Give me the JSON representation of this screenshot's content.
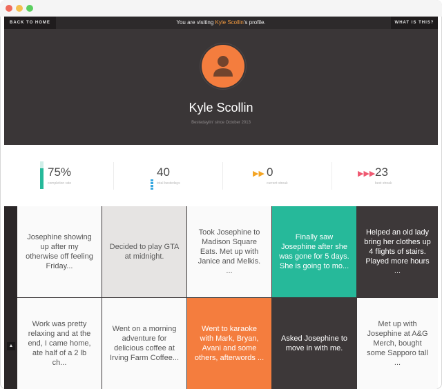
{
  "topbar": {
    "back_label": "BACK TO HOME",
    "what_label": "WHAT IS THIS?",
    "visit_prefix": "You are visiting ",
    "visit_name": "Kyle Scollin",
    "visit_suffix": "'s profile."
  },
  "profile": {
    "avatar_icon": "user-silhouette-icon",
    "name": "Kyle Scollin",
    "since": "Bestedaylin' since October 2013"
  },
  "stats": {
    "completion": {
      "value": "75%",
      "label": "completion rate",
      "fraction": 0.75,
      "color": "#26b99a"
    },
    "total": {
      "value": "40",
      "label": "total bestedays",
      "color": "#38a8e0"
    },
    "current": {
      "value": "0",
      "label": "current streak",
      "icon": "double-chevron-icon",
      "color": "#f4a524"
    },
    "best": {
      "value": "23",
      "label": "best streak",
      "icon": "triple-chevron-icon",
      "color": "#ef5a72"
    }
  },
  "cards": [
    {
      "text": "Josephine showing up after my otherwise off feeling Friday...",
      "style": "white"
    },
    {
      "text": "Decided to play GTA at midnight.",
      "style": "gray"
    },
    {
      "text": "Took Josephine to Madison Square Eats. Met up with Janice and Melkis. ...",
      "style": "white"
    },
    {
      "text": "Finally saw Josephine after she was gone for 5 days. She is going to mo...",
      "style": "teal"
    },
    {
      "text": "Helped an old lady bring her clothes up 4 flights of stairs. Played more hours ...",
      "style": "dark"
    },
    {
      "text": "Work was pretty relaxing and at the end, I came home, ate half of a 2 lb ch...",
      "style": "white"
    },
    {
      "text": "Went on a morning adventure for delicious coffee at Irving Farm Coffee...",
      "style": "white"
    },
    {
      "text": "Went to karaoke with Mark, Bryan, Avani and some others, afterwords ...",
      "style": "orange"
    },
    {
      "text": "Asked Josephine to move in with me.",
      "style": "dark"
    },
    {
      "text": "Met up with Josephine at A&G Merch, bought some Sapporo tall ...",
      "style": "white"
    }
  ],
  "scroll_up_icon": "caret-up-icon"
}
